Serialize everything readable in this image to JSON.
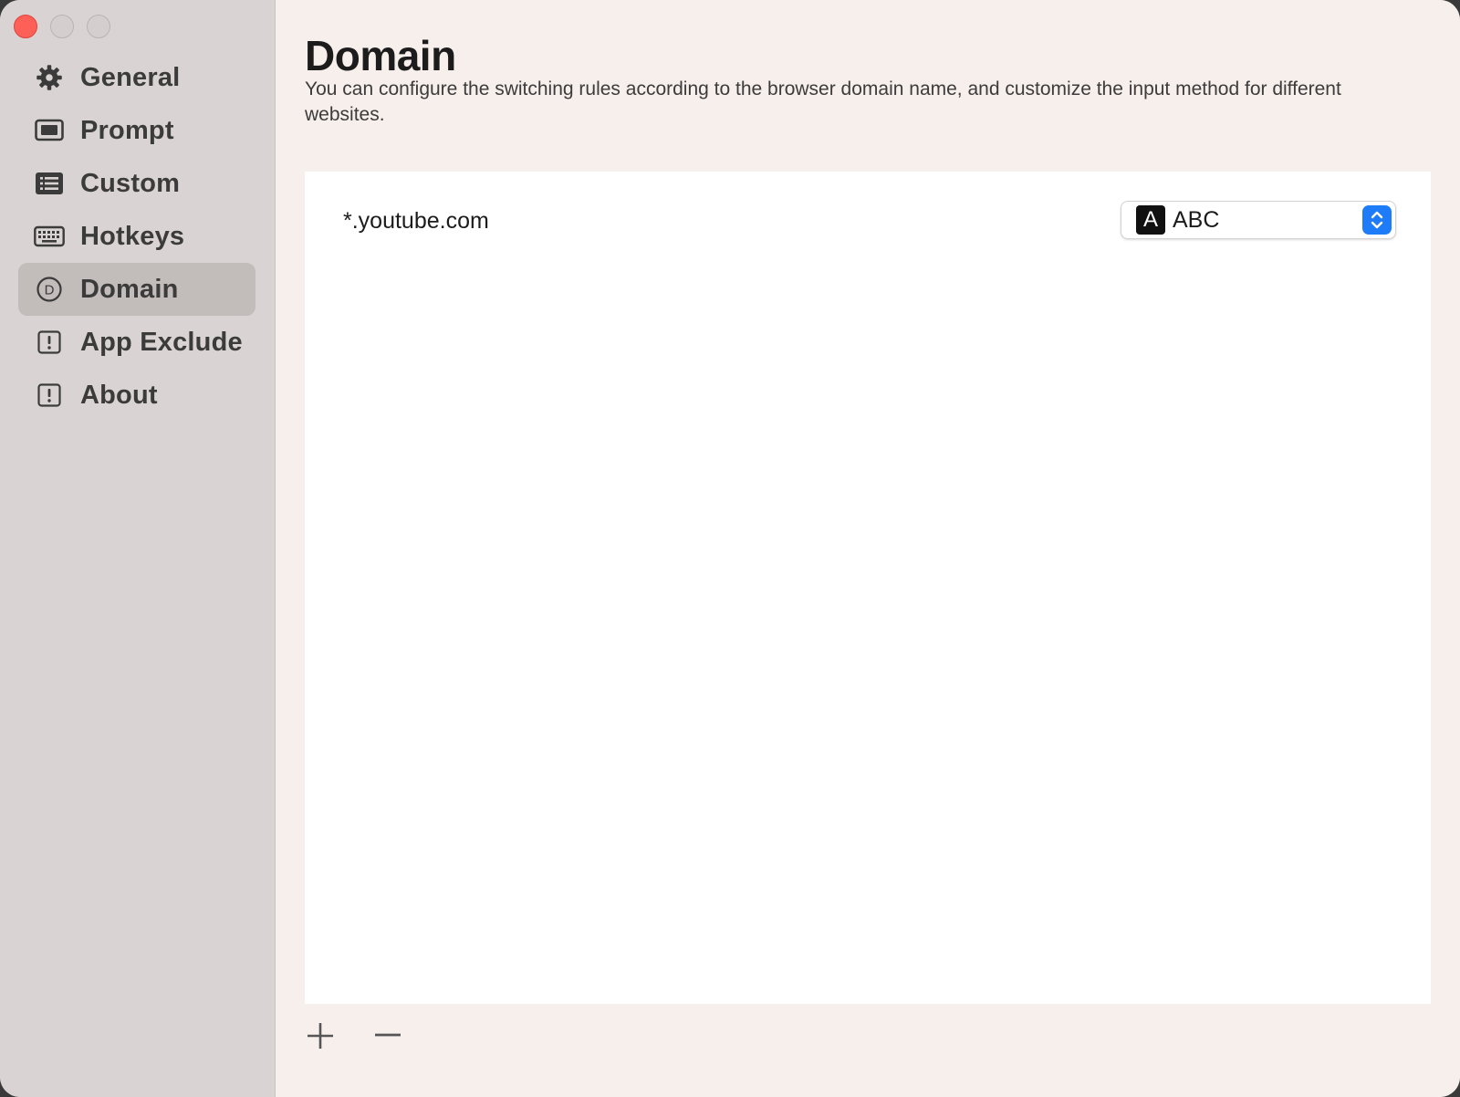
{
  "window": {
    "controls": [
      "close",
      "minimize",
      "zoom"
    ]
  },
  "sidebar": {
    "items": [
      {
        "label": "General",
        "icon": "gear-icon",
        "active": false
      },
      {
        "label": "Prompt",
        "icon": "display-icon",
        "active": false
      },
      {
        "label": "Custom",
        "icon": "list-icon",
        "active": false
      },
      {
        "label": "Hotkeys",
        "icon": "keyboard-icon",
        "active": false
      },
      {
        "label": "Domain",
        "icon": "circle-d-icon",
        "active": true
      },
      {
        "label": "App Exclude",
        "icon": "exclamation-square-icon",
        "active": false
      },
      {
        "label": "About",
        "icon": "exclamation-square-icon",
        "active": false
      }
    ]
  },
  "main": {
    "title": "Domain",
    "description": "You can configure the switching rules according to the browser domain name, and customize the input method for different websites.",
    "rows": [
      {
        "domain": "*.youtube.com",
        "input_badge": "A",
        "input_method": "ABC"
      }
    ],
    "toolbar": {
      "add_icon": "plus-icon",
      "remove_icon": "minus-icon"
    }
  },
  "colors": {
    "accent": "#1e7cf8",
    "close": "#fe5f57",
    "sidebar_bg": "#d9d4d3",
    "sidebar_active": "#c2bcbb",
    "content_bg": "#f6efec"
  }
}
